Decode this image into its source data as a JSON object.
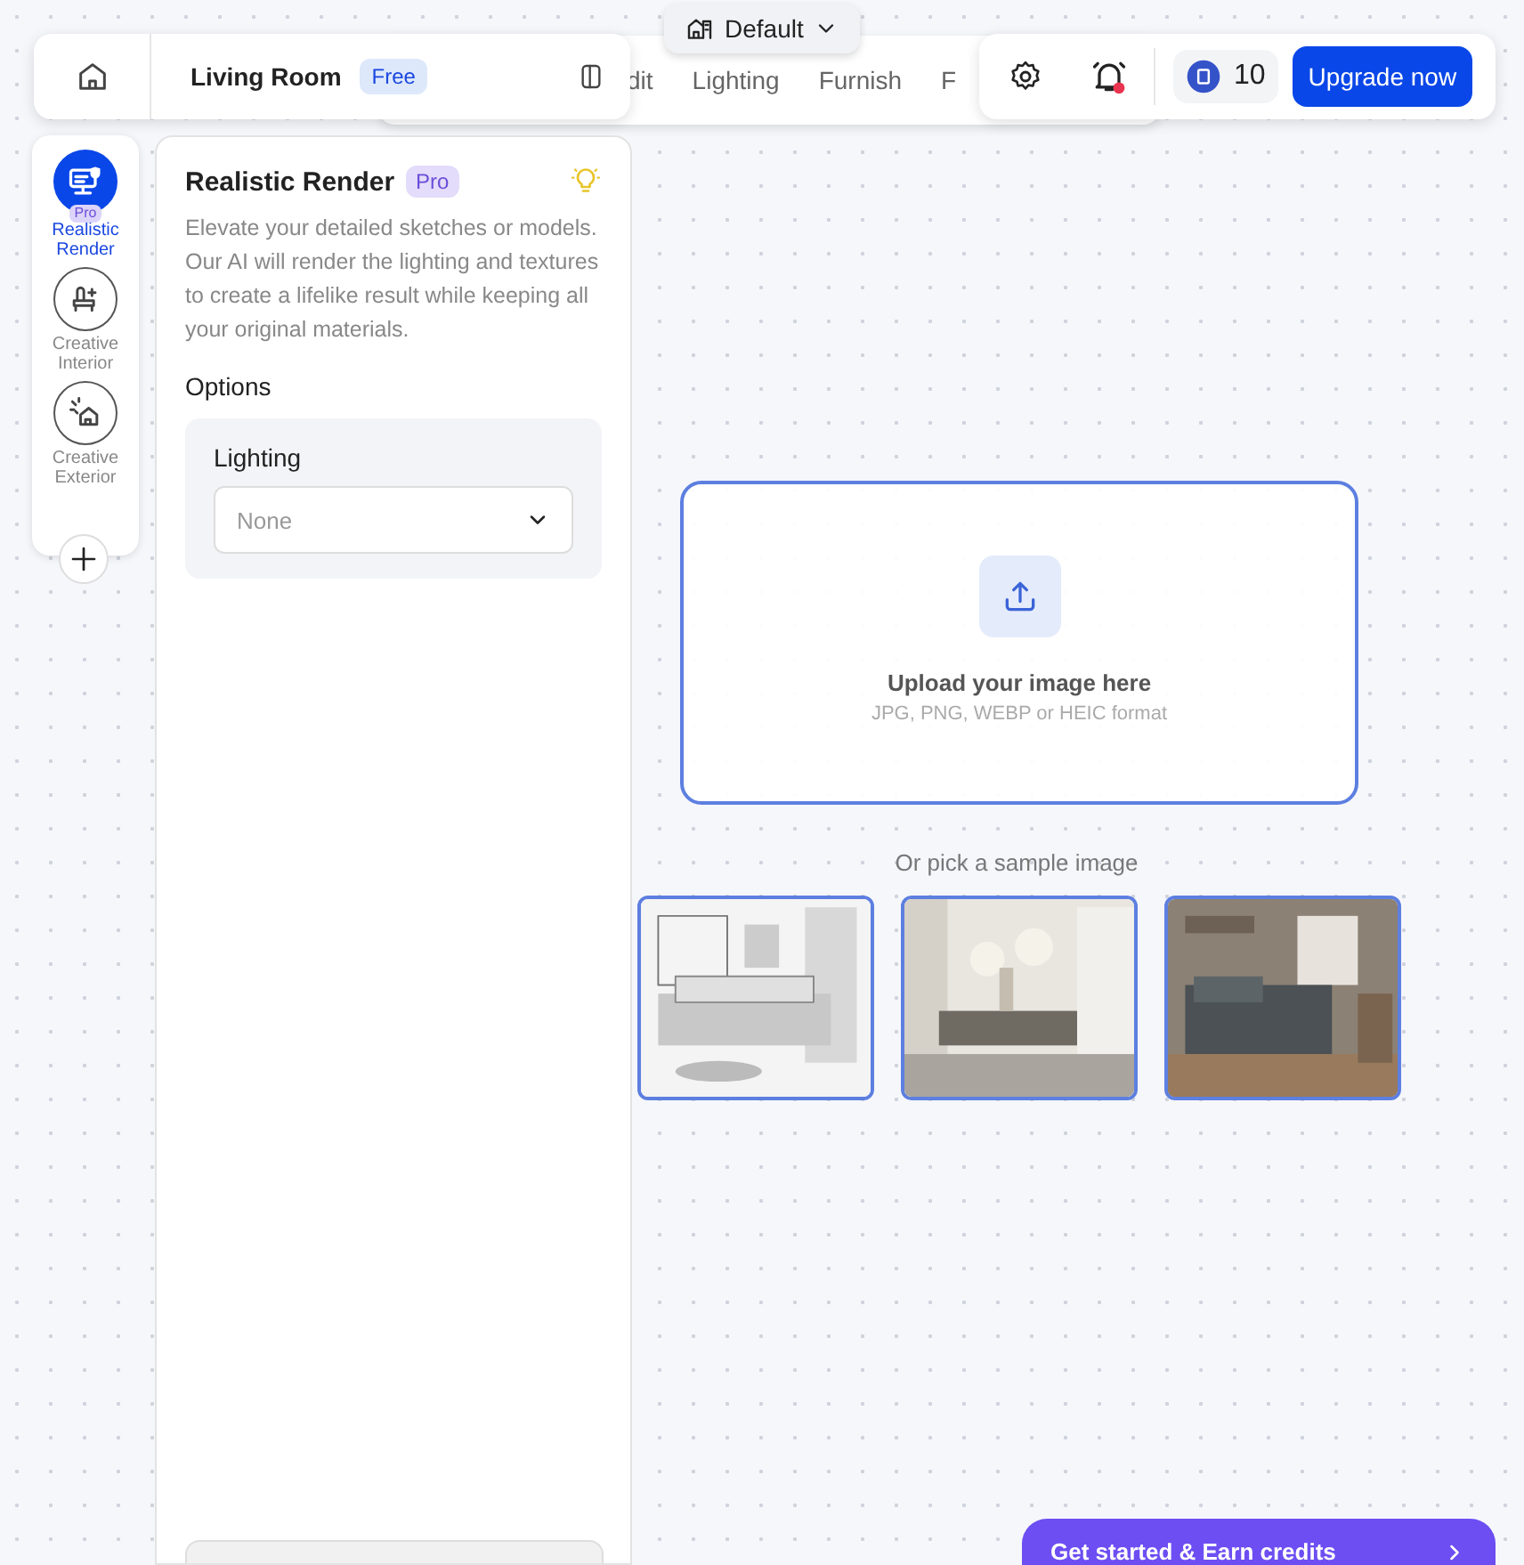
{
  "project": {
    "name": "Living Room",
    "plan": "Free"
  },
  "view_menu": {
    "label": "Default"
  },
  "tabs": [
    {
      "label": "dit",
      "selected": false
    },
    {
      "label": "Lighting",
      "selected": false
    },
    {
      "label": "Furnish",
      "selected": false
    },
    {
      "label": "F",
      "selected": false
    }
  ],
  "notifications": {
    "unread": true
  },
  "credits": "10",
  "upgrade_button": "Upgrade now",
  "tools": [
    {
      "label": "Realistic Render",
      "badge": "Pro",
      "selected": true
    },
    {
      "label": "Creative Interior",
      "selected": false
    },
    {
      "label": "Creative Exterior",
      "selected": false
    }
  ],
  "panel": {
    "title": "Realistic Render",
    "badge": "Pro",
    "description": "Elevate your detailed sketches or models. Our AI will render the lighting and textures to create a lifelike result while keeping all your original materials.",
    "options_heading": "Options",
    "options": [
      {
        "label": "Lighting",
        "placeholder": "None"
      }
    ]
  },
  "upload": {
    "title": "Upload your image here",
    "hint": "JPG, PNG, WEBP or HEIC format"
  },
  "samples": {
    "heading": "Or pick a sample image"
  },
  "cta": "Get started & Earn credits"
}
